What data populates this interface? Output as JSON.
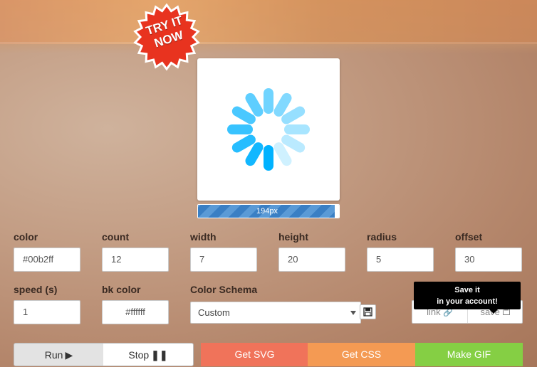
{
  "badge": {
    "text": "TRY IT NOW"
  },
  "preview": {
    "size_label": "194px",
    "size_fraction": 0.97
  },
  "spinner": {
    "color": "#00b2ff",
    "count": 12,
    "width": 7,
    "height": 20,
    "radius": 5,
    "offset": 30
  },
  "fields": {
    "color": {
      "label": "color",
      "value": "#00b2ff"
    },
    "count": {
      "label": "count",
      "value": "12"
    },
    "width": {
      "label": "width",
      "value": "7"
    },
    "height": {
      "label": "height",
      "value": "20"
    },
    "radius": {
      "label": "radius",
      "value": "5"
    },
    "offset": {
      "label": "offset",
      "value": "30"
    },
    "speed": {
      "label": "speed (s)",
      "value": "1"
    },
    "bkcolor": {
      "label": "bk color",
      "value": "#ffffff"
    },
    "schema": {
      "label": "Color Schema",
      "value": "Custom"
    }
  },
  "actions": {
    "link": "link",
    "save": "save",
    "tooltip_line1": "Save it",
    "tooltip_line2": "in your account!"
  },
  "buttons": {
    "run": "Run",
    "stop": "Stop",
    "svg": "Get SVG",
    "css": "Get CSS",
    "gif": "Make GIF"
  },
  "colors": {
    "svg": "#f0735a",
    "css": "#f49a53",
    "gif": "#85cf44",
    "bar": "#3a7fc4"
  }
}
